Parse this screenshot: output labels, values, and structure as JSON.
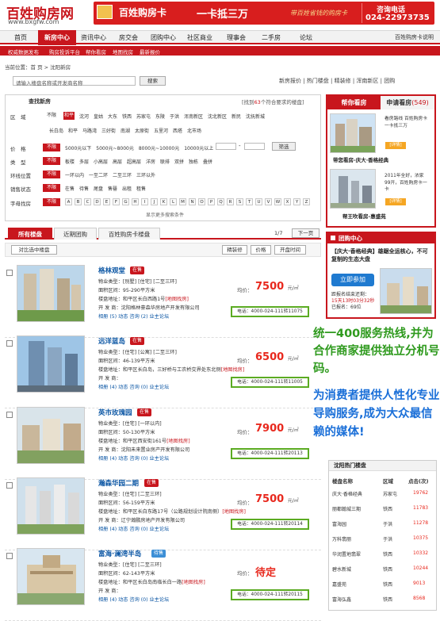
{
  "header": {
    "logo": "百姓购房网",
    "url": "www.bxgfw.com",
    "banner_name": "百姓购房卡",
    "banner_slogan": "一卡抵三万",
    "banner_mid": "带百姓省钱的购房卡",
    "hotline_label": "咨询电话",
    "hotline_number": "024-22973735"
  },
  "nav": {
    "items": [
      "首页",
      "新房中心",
      "资讯中心",
      "房交会",
      "团购中心",
      "社区商业",
      "理事会",
      "二手房",
      "论坛"
    ],
    "active": "新房中心",
    "right": "百姓购房卡说明"
  },
  "subnav": [
    "权威数据发布",
    "购房投诉平台",
    "帮你看房",
    "地图找房",
    "最新报价"
  ],
  "breadcrumb": "当前位置：首 页 > 沈阳新房",
  "search": {
    "placeholder": "请输入楼盘名称或开发商名称",
    "button": "搜索",
    "quick_links": "新房报价 | 热门楼盘 | 精装修 | 浑南新区 | 团购"
  },
  "filter": {
    "title": "查找新房",
    "count_pre": "[找到",
    "count": "63",
    "count_post": "个符合要求的楼盘]",
    "rows": [
      {
        "label": "区　域",
        "any": "不限",
        "sel": "和平",
        "opts": "沈河　皇姑　大东　铁西　苏家屯　东陵　于洪　浑南新区　沈北新区　新民　沈抚新城"
      },
      {
        "label": "",
        "any": "",
        "sel": "",
        "opts": "长白岛　和平　马路湾　三好街　南湖　太原街　五里河　西塔　北市场"
      },
      {
        "label": "价　格",
        "any": "不限",
        "sel": "",
        "opts": "5000元以下　5000元~8000元　8000元~10000元　10000元以上"
      },
      {
        "label": "类　型",
        "any": "不限",
        "sel": "",
        "opts": "板楼　多层　小高层　高层　超高层　洋房　联排　双拼　独栋　叠拼"
      },
      {
        "label": "环线位置",
        "any": "不限",
        "sel": "",
        "opts": "一环以内　一至二环　二至三环　三环以外"
      },
      {
        "label": "销售状态",
        "any": "不限",
        "sel": "",
        "opts": "在售　待售　尾盘　售罄　出租　租售"
      },
      {
        "label": "字母找房",
        "any": "不限",
        "sel": "",
        "opts": ""
      }
    ],
    "letters": [
      "A",
      "B",
      "C",
      "D",
      "E",
      "F",
      "G",
      "H",
      "I",
      "J",
      "K",
      "L",
      "M",
      "N",
      "O",
      "P",
      "Q",
      "R",
      "S",
      "T",
      "U",
      "V",
      "W",
      "X",
      "Y",
      "Z"
    ],
    "price_button": "筛选",
    "price_sep": "-",
    "more": "显示更多搜索条件"
  },
  "tabs": [
    "所有楼盘",
    "近期团购",
    "百姓购房卡楼盘"
  ],
  "page_indicator": "1/7",
  "next_page": "下一页",
  "compare": "对比选中楼盘",
  "sort": [
    "精装修",
    "价格",
    "开盘时间"
  ],
  "listings": [
    {
      "name": "格林观堂",
      "badge": "在售",
      "type": "物业类型：[别墅] [住宅] [二至三环]",
      "area": "面积区间：95-290平方米",
      "address": "楼盘地址：和平区长白西路1号",
      "map": "[地图找房]",
      "developer": "开 发 商：沈阳格林豪森华房地产开发有限公司",
      "links": "相册 (5)  动态  咨询 (2)  业主论坛",
      "price_label": "均价：",
      "price": "7500",
      "unit": "元/㎡",
      "phone": "电话：4000-024-111转11075"
    },
    {
      "name": "远洋蓝岛",
      "badge": "在售",
      "type": "物业类型：[住宅] [公寓] [二至三环]",
      "area": "面积区间：46-139平方米",
      "address": "楼盘地址：和平区长白岛，三好桥与工农桥交界处东北侧",
      "map": "[地图找房]",
      "developer": "开 发 商：",
      "links": "相册 (4)  动态  咨询 (0)  业主论坛",
      "price_label": "均价：",
      "price": "6500",
      "unit": "元/㎡",
      "phone": "电话：4000-024-111转11005"
    },
    {
      "name": "英市玫瑰园",
      "badge": "在售",
      "type": "物业类型：[住宅] [一环以内]",
      "area": "面积区间：50-130平方米",
      "address": "楼盘地址：和平区西安街161号",
      "map": "[地图找房]",
      "developer": "开 发 商：沈阳未来置业房产开发有限公司",
      "links": "相册 (4)  动态  咨询 (0)  业主论坛",
      "price_label": "均价：",
      "price": "7900",
      "unit": "元/㎡",
      "phone": "电话：4000-024-111转20113"
    },
    {
      "name": "瀚森华园二期",
      "badge": "在售",
      "type": "物业类型：[住宅] [二至三环]",
      "area": "面积区间：56-159平方米",
      "address": "楼盘地址：和平区长白东路17号（公路规划设计院南侧）",
      "map": "[地图找房]",
      "developer": "开 发 商：辽宁瀚鹏房地产开发有限公司",
      "links": "相册 (4)  动态  咨询 (0)  业主论坛",
      "price_label": "均价：",
      "price": "7500",
      "unit": "元/㎡",
      "phone": "电话：4000-024-111转20114"
    },
    {
      "name": "富海·澜湾半岛",
      "badge": "待售",
      "type": "物业类型：[住宅] [二至三环]",
      "area": "面积区间：62-143平方米",
      "address": "楼盘地址：和平区长白岛南临长白一路",
      "map": "[地图找房]",
      "developer": "开 发 商：",
      "links": "相册 (4)  动态  咨询 (0)  业主论坛",
      "price_label": "均价：",
      "price": "待定",
      "unit": "",
      "phone": "电话：4000-024-111转20115"
    }
  ],
  "sidebar": {
    "tab1": "帮你看房",
    "tab2_pre": "申请看房",
    "tab2_count": "(549)",
    "item1_text": "看房路线 百姓购房卡一卡抵三万",
    "item1_more": "[详情]",
    "item1_caption": "带您看房-庆大·香格经典",
    "item2_text": "2011年全好，浓家99开，百姓购房卡一卡",
    "item2_more": "[详情]",
    "item2_caption": "帮王吹看房-惠盛苑",
    "group_title": "团购中心",
    "group_headline": "【庆大·香格经典】雄踞全运核心，不可复制的生态大盘",
    "join_button": "立即参加",
    "deadline_line1": "距报名结束还剩：",
    "deadline_line2": "15天13时03分32秒",
    "deadline_line3": "已报名：69位"
  },
  "promo": {
    "line1": "统一400服务热线,并为合作商家提供独立分机号码。",
    "line2": "为消费者提供人性化专业导购服务,成为大众最信赖的媒体!"
  },
  "hot": {
    "title": "沈阳热门楼盘",
    "headers": [
      "楼盘名称",
      "区域",
      "点击(次)"
    ],
    "rows": [
      [
        "庆大·香格经典",
        "苏家屯",
        "19762"
      ],
      [
        "丽都翰城三期",
        "铁西",
        "11783"
      ],
      [
        "富海园",
        "于洪",
        "11278"
      ],
      [
        "万科翡丽",
        "于洪",
        "10375"
      ],
      [
        "华润置地翡翠",
        "铁西",
        "10332"
      ],
      [
        "碧水新城",
        "铁西",
        "10244"
      ],
      [
        "嘉盛苑",
        "铁西",
        "9013"
      ],
      [
        "富海弘鑫",
        "铁西",
        "8568"
      ]
    ]
  },
  "colors": {
    "brand": "#c8161d",
    "link": "#0b56a4",
    "price": "#e8281d",
    "promo_green": "#2f9a1e",
    "promo_blue": "#1a6fd8"
  }
}
